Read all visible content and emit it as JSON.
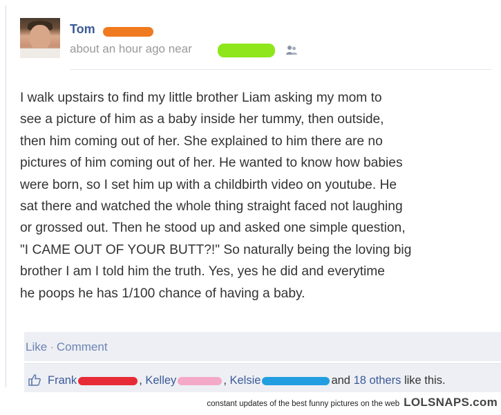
{
  "post": {
    "author_name": "Tom",
    "timestamp": "about an hour ago near",
    "audience_icon": "friends-icon",
    "body": "I walk upstairs to find my little brother Liam asking my mom to\nsee a picture of him as a baby inside her tummy, then outside,\nthen him coming out of her. She explained to him there are no\npictures of him coming out of her. He wanted to know how babies\nwere born, so I set him up with a childbirth video on youtube. He\nsat there and watched the whole thing straight faced not laughing\nor grossed out. Then he stood up and asked one simple question,\n\"I CAME OUT OF YOUR BUTT?!\" So naturally being the loving big\nbrother I am I told him the truth. Yes, yes he did and everytime\nhe poops he has 1/100 chance of having a baby.",
    "redaction_colors": {
      "author": "#f07a1f",
      "location": "#8fe61a",
      "frank": "#e62b37",
      "kelley": "#f4a9c9",
      "kelsie": "#229ee0"
    }
  },
  "actions": {
    "like_label": "Like",
    "separator": "·",
    "comment_label": "Comment"
  },
  "likes": {
    "liker1": "Frank",
    "sep1": ", ",
    "liker2": "Kelley",
    "sep2": ", ",
    "liker3": "Kelsie",
    "and_text": "and ",
    "others": "18 others",
    "suffix": " like this."
  },
  "footer": {
    "tagline": "constant updates of the best funny pictures on the web",
    "brand": "LOLSNAPS.com"
  }
}
